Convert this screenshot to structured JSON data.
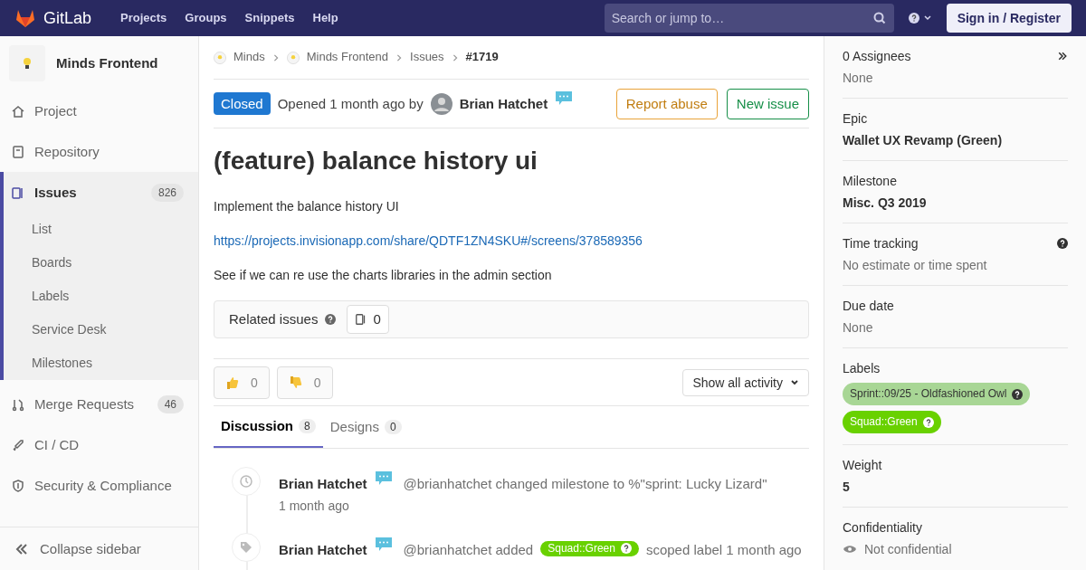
{
  "navbar": {
    "brand": "GitLab",
    "links": [
      "Projects",
      "Groups",
      "Snippets",
      "Help"
    ],
    "search": {
      "placeholder": "Search or jump to…"
    },
    "sign_in": "Sign in / Register"
  },
  "sidebar": {
    "project": "Minds Frontend",
    "items": [
      {
        "label": "Project",
        "selected": false
      },
      {
        "label": "Repository",
        "selected": false
      },
      {
        "label": "Issues",
        "count": "826",
        "selected": true,
        "children": [
          {
            "label": "List"
          },
          {
            "label": "Boards"
          },
          {
            "label": "Labels"
          },
          {
            "label": "Service Desk"
          },
          {
            "label": "Milestones"
          }
        ]
      },
      {
        "label": "Merge Requests",
        "count": "46",
        "selected": false
      },
      {
        "label": "CI / CD",
        "selected": false
      },
      {
        "label": "Security & Compliance",
        "selected": false
      }
    ],
    "collapse": "Collapse sidebar"
  },
  "breadcrumbs": [
    {
      "label": "Minds",
      "avatar": true
    },
    {
      "label": "Minds Frontend",
      "avatar": true
    },
    {
      "label": "Issues",
      "avatar": false
    },
    {
      "label": "#1719",
      "avatar": false
    }
  ],
  "issue": {
    "status": "Closed",
    "opened": "Opened 1 month ago by",
    "author": "Brian Hatchet",
    "actions": [
      {
        "label": "Report abuse",
        "kind": "warning"
      },
      {
        "label": "New issue",
        "kind": "success"
      }
    ],
    "title": "(feature) balance history ui",
    "description": [
      {
        "kind": "text",
        "text": "Implement the balance history UI"
      },
      {
        "kind": "link",
        "text": "https://projects.invisionapp.com/share/QDTF1ZN4SKU#/screens/378589356"
      },
      {
        "kind": "text",
        "text": "See if we can re use the charts libraries in the admin section"
      }
    ],
    "related": {
      "label": "Related issues",
      "count": "0"
    },
    "awards": [
      {
        "kind": "thumbsup",
        "count": "0"
      },
      {
        "kind": "thumbsdown",
        "count": "0"
      }
    ],
    "activity_filter": "Show all activity",
    "tabs": [
      {
        "label": "Discussion",
        "count": "8",
        "selected": true
      },
      {
        "label": "Designs",
        "count": "0",
        "selected": false
      }
    ],
    "timeline": [
      {
        "kind": "milestone",
        "author": "Brian Hatchet",
        "text": "@brianhatchet changed milestone to %\"sprint: Lucky Lizard\"",
        "time": "1 month ago"
      },
      {
        "kind": "label",
        "author": "Brian Hatchet",
        "text": "@brianhatchet added",
        "label": {
          "text": "Squad::Green",
          "color": "#69d100"
        },
        "after": "scoped label 1 month ago"
      }
    ]
  },
  "right_sidebar": {
    "sections": [
      {
        "kind": "assignees",
        "title": "0 Assignees",
        "value": "None"
      },
      {
        "kind": "bold",
        "title": "Epic",
        "value": "Wallet UX Revamp (Green)"
      },
      {
        "kind": "bold",
        "title": "Milestone",
        "value": "Misc. Q3 2019"
      },
      {
        "kind": "help",
        "title": "Time tracking",
        "value": "No estimate or time spent"
      },
      {
        "kind": "muted",
        "title": "Due date",
        "value": "None"
      },
      {
        "kind": "labels",
        "title": "Labels",
        "labels": [
          {
            "text": "Sprint::09/25 - Oldfashioned Owl",
            "color": "#a8d695"
          },
          {
            "text": "Squad::Green",
            "color": "#69d100"
          }
        ]
      },
      {
        "kind": "bold",
        "title": "Weight",
        "value": "5"
      },
      {
        "kind": "eye",
        "title": "Confidentiality",
        "value": "Not confidential"
      }
    ]
  }
}
